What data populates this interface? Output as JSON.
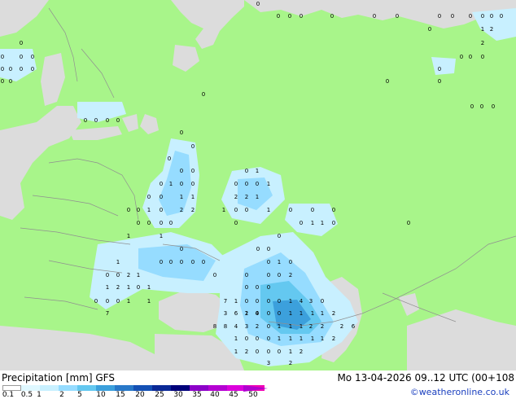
{
  "map": {
    "land_color": "#a8f58a",
    "sea_color": "#dcdcdc",
    "precip_colors": [
      "#c8f0ff",
      "#96dcff",
      "#64c8f0",
      "#3ca0dc",
      "#2878c8",
      "#1450b4",
      "#0a2896"
    ],
    "values": [
      {
        "t": "0"
      },
      {
        "t": "0"
      },
      {
        "t": "0"
      },
      {
        "t": "0"
      },
      {
        "t": "0"
      },
      {
        "t": "0"
      },
      {
        "t": "0"
      },
      {
        "t": "0"
      },
      {
        "t": "0"
      },
      {
        "t": "0"
      },
      {
        "t": "0"
      },
      {
        "t": "0"
      },
      {
        "t": "0"
      },
      {
        "t": "1"
      },
      {
        "t": "2"
      },
      {
        "t": "0"
      },
      {
        "t": "0"
      },
      {
        "t": "2"
      },
      {
        "t": "0"
      },
      {
        "t": "0"
      },
      {
        "t": "0"
      },
      {
        "t": "0"
      },
      {
        "t": "0"
      },
      {
        "t": "0"
      },
      {
        "t": "0"
      },
      {
        "t": "0"
      },
      {
        "t": "0"
      },
      {
        "t": "0"
      },
      {
        "t": "0"
      },
      {
        "t": "0"
      },
      {
        "t": "0"
      },
      {
        "t": "0"
      },
      {
        "t": "0"
      },
      {
        "t": "0"
      },
      {
        "t": "0"
      },
      {
        "t": "0"
      },
      {
        "t": "0"
      },
      {
        "t": "0"
      },
      {
        "t": "0"
      },
      {
        "t": "0"
      },
      {
        "t": "0"
      },
      {
        "t": "0"
      },
      {
        "t": "0"
      },
      {
        "t": "0"
      },
      {
        "t": "0"
      },
      {
        "t": "0"
      },
      {
        "t": "0"
      },
      {
        "t": "1"
      },
      {
        "t": "0"
      },
      {
        "t": "0"
      },
      {
        "t": "0"
      },
      {
        "t": "1"
      },
      {
        "t": "0"
      },
      {
        "t": "0"
      },
      {
        "t": "1"
      },
      {
        "t": "1"
      },
      {
        "t": "0"
      },
      {
        "t": "0"
      },
      {
        "t": "0"
      },
      {
        "t": "1"
      },
      {
        "t": "2"
      },
      {
        "t": "2"
      },
      {
        "t": "1"
      },
      {
        "t": "0"
      },
      {
        "t": "0"
      },
      {
        "t": "1"
      },
      {
        "t": "0"
      },
      {
        "t": "2"
      },
      {
        "t": "2"
      },
      {
        "t": "1"
      },
      {
        "t": "0"
      },
      {
        "t": "0"
      },
      {
        "t": "1"
      },
      {
        "t": "0"
      },
      {
        "t": "0"
      },
      {
        "t": "0"
      },
      {
        "t": "0"
      },
      {
        "t": "0"
      },
      {
        "t": "0"
      },
      {
        "t": "0"
      },
      {
        "t": "0"
      },
      {
        "t": "0"
      },
      {
        "t": "1"
      },
      {
        "t": "1"
      },
      {
        "t": "0"
      },
      {
        "t": "0"
      },
      {
        "t": "1"
      },
      {
        "t": "1"
      },
      {
        "t": "0"
      },
      {
        "t": "0"
      },
      {
        "t": "0"
      },
      {
        "t": "0"
      },
      {
        "t": "1"
      },
      {
        "t": "0"
      },
      {
        "t": "0"
      },
      {
        "t": "0"
      },
      {
        "t": "0"
      },
      {
        "t": "0"
      },
      {
        "t": "0"
      },
      {
        "t": "1"
      },
      {
        "t": "0"
      },
      {
        "t": "0"
      },
      {
        "t": "0"
      },
      {
        "t": "0"
      },
      {
        "t": "2"
      },
      {
        "t": "1"
      },
      {
        "t": "0"
      },
      {
        "t": "0"
      },
      {
        "t": "0"
      },
      {
        "t": "2"
      },
      {
        "t": "0"
      },
      {
        "t": "0"
      },
      {
        "t": "0"
      },
      {
        "t": "1"
      },
      {
        "t": "2"
      },
      {
        "t": "1"
      },
      {
        "t": "0"
      },
      {
        "t": "1"
      },
      {
        "t": "1"
      },
      {
        "t": "0"
      },
      {
        "t": "0"
      },
      {
        "t": "0"
      },
      {
        "t": "0"
      },
      {
        "t": "1"
      },
      {
        "t": "4"
      },
      {
        "t": "3"
      },
      {
        "t": "0"
      },
      {
        "t": "0"
      },
      {
        "t": "0"
      },
      {
        "t": "0"
      },
      {
        "t": "1"
      },
      {
        "t": "1"
      },
      {
        "t": "1"
      },
      {
        "t": "4"
      },
      {
        "t": "6"
      },
      {
        "t": "2"
      },
      {
        "t": "0"
      },
      {
        "t": "0"
      },
      {
        "t": "0"
      },
      {
        "t": "1"
      },
      {
        "t": "1"
      },
      {
        "t": "1"
      },
      {
        "t": "1"
      },
      {
        "t": "2"
      },
      {
        "t": "7"
      },
      {
        "t": "7"
      },
      {
        "t": "8"
      },
      {
        "t": "4"
      },
      {
        "t": "3"
      },
      {
        "t": "2"
      },
      {
        "t": "0"
      },
      {
        "t": "1"
      },
      {
        "t": "1"
      },
      {
        "t": "1"
      },
      {
        "t": "2"
      },
      {
        "t": "2"
      },
      {
        "t": "2"
      },
      {
        "t": "6"
      },
      {
        "t": "8"
      },
      {
        "t": "3"
      },
      {
        "t": "1"
      },
      {
        "t": "0"
      },
      {
        "t": "0"
      },
      {
        "t": "0"
      },
      {
        "t": "1"
      },
      {
        "t": "1"
      },
      {
        "t": "1"
      },
      {
        "t": "1"
      },
      {
        "t": "1"
      },
      {
        "t": "2"
      },
      {
        "t": "1"
      },
      {
        "t": "2"
      },
      {
        "t": "0"
      },
      {
        "t": "0"
      },
      {
        "t": "0"
      },
      {
        "t": "1"
      },
      {
        "t": "2"
      },
      {
        "t": "3"
      },
      {
        "t": "2"
      },
      {
        "t": "2"
      },
      {
        "t": "1"
      },
      {
        "t": "0"
      },
      {
        "t": "0"
      }
    ]
  },
  "legend": {
    "title": "Precipitation [mm]  GFS",
    "valid": "Mo 13-04-2026 09..12 UTC (00+108",
    "credit": "©weatheronline.co.uk",
    "scale": [
      {
        "color": "#ffffff",
        "label": "0.1"
      },
      {
        "color": "#e0f8ff",
        "label": "0.5"
      },
      {
        "color": "#c8f0ff",
        "label": "1"
      },
      {
        "color": "#96dcff",
        "label": "2"
      },
      {
        "color": "#64c8f0",
        "label": "5"
      },
      {
        "color": "#3ca0dc",
        "label": "10"
      },
      {
        "color": "#2878c8",
        "label": "15"
      },
      {
        "color": "#1450b4",
        "label": "20"
      },
      {
        "color": "#0a2896",
        "label": "25"
      },
      {
        "color": "#00007a",
        "label": "30"
      },
      {
        "color": "#8c00c8",
        "label": "35"
      },
      {
        "color": "#b400d2",
        "label": "40"
      },
      {
        "color": "#dc00dc",
        "label": "45"
      },
      {
        "color": "#f000b4",
        "label": "50"
      }
    ]
  }
}
